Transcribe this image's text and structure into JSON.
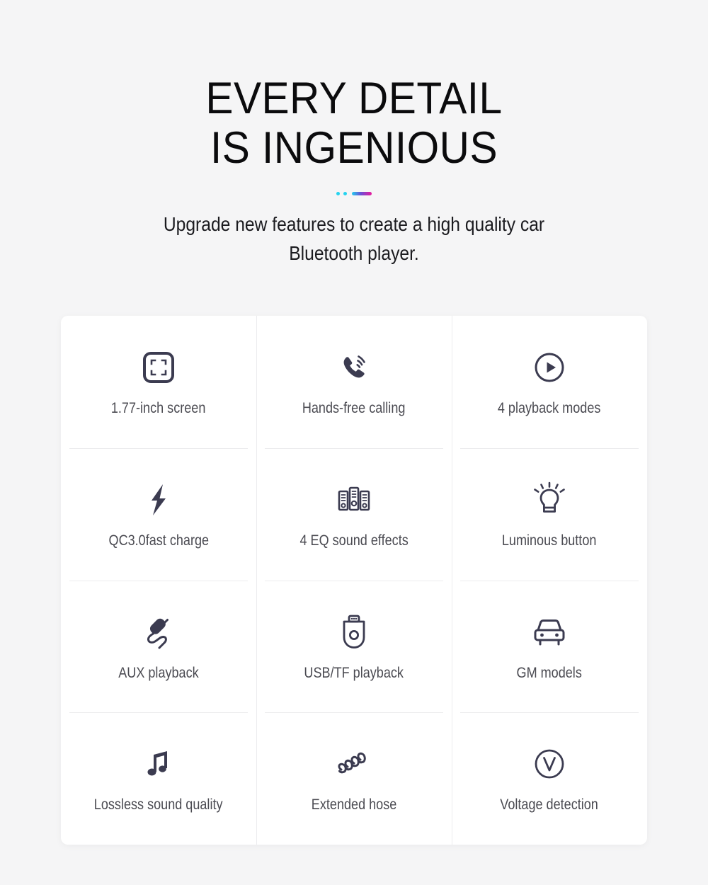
{
  "header": {
    "title_line1": "EVERY DETAIL",
    "title_line2": "IS INGENIOUS",
    "subtitle": "Upgrade new features to create a high quality car Bluetooth player."
  },
  "theme": {
    "page_background": "#f5f5f6",
    "card_background": "#ffffff",
    "icon_color": "#3b3b50",
    "label_color": "#4b4b52",
    "title_color": "#0b0b0d",
    "divider_line": "#ececee",
    "accent_cyan": "#25d3ef",
    "accent_magenta": "#e8199b"
  },
  "features": [
    {
      "icon": "screen-frame-icon",
      "label": "1.77-inch screen"
    },
    {
      "icon": "phone-call-icon",
      "label": "Hands-free calling"
    },
    {
      "icon": "play-circle-icon",
      "label": "4 playback modes"
    },
    {
      "icon": "lightning-bolt-icon",
      "label": "QC3.0fast charge"
    },
    {
      "icon": "equalizer-icon",
      "label": "4 EQ sound effects"
    },
    {
      "icon": "light-bulb-icon",
      "label": "Luminous button"
    },
    {
      "icon": "audio-plug-icon",
      "label": "AUX playback"
    },
    {
      "icon": "usb-drive-icon",
      "label": "USB/TF playback"
    },
    {
      "icon": "car-front-icon",
      "label": "GM models"
    },
    {
      "icon": "music-note-icon",
      "label": "Lossless sound quality"
    },
    {
      "icon": "coiled-hose-icon",
      "label": "Extended hose"
    },
    {
      "icon": "voltage-circle-icon",
      "label": "Voltage detection"
    }
  ]
}
